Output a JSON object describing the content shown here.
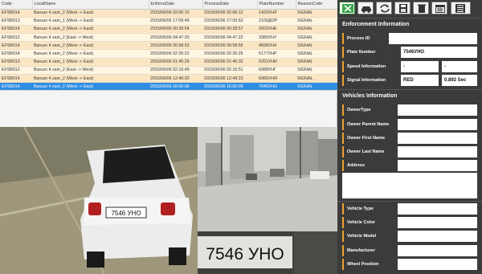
{
  "table": {
    "columns": [
      "Code",
      "LocalName",
      "EnforceDate",
      "ProcessDate",
      "PlateNumber",
      "ReasonCode"
    ],
    "rows": [
      [
        "EFSB014",
        "Baruun 4 zam_2 (West -> East)",
        "2015/06/06 02:06:10",
        "2015/06/06 02:06:12",
        "1429УНЛ",
        "SIGNAL"
      ],
      [
        "EFSB013",
        "Baruun 4 zam_1 (West -> East)",
        "2015/06/06 17:09:49",
        "2015/06/06 17:09:52",
        "2100ДОР",
        "SIGNAL"
      ],
      [
        "EFSB014",
        "Baruun 4 zam_2 (West -> East)",
        "2015/06/06 00:28:54",
        "2015/06/06 00:28:57",
        "2602УНЕ",
        "SIGNAL"
      ],
      [
        "EFSB012",
        "Baruun 4 zam_2 (East -> West)",
        "2015/06/06 04:47:20",
        "2015/06/06 04:47:22",
        "3380УНУ",
        "SIGNAL"
      ],
      [
        "EFSB014",
        "Baruun 4 zam_2 (West -> East)",
        "2015/06/06 00:58:53",
        "2015/06/06 00:58:55",
        "4838УНХ",
        "SIGNAL"
      ],
      [
        "EFSB014",
        "Baruun 4 zam_2 (West -> East)",
        "2015/06/06 02:26:22",
        "2015/06/06 02:26:25",
        "5177УНР",
        "SIGNAL"
      ],
      [
        "EFSB013",
        "Baruun 4 zam_1 (West -> East)",
        "2015/06/06 01:45:29",
        "2015/06/06 01:45:32",
        "5201УНИ",
        "SIGNAL"
      ],
      [
        "EFSB012",
        "Baruun 4 zam_2 (East -> West)",
        "2015/06/06 02:16:49",
        "2015/06/06 02:16:51",
        "6088УНГ",
        "SIGNAL"
      ],
      [
        "EFSB014",
        "Baruun 4 zam_2 (West -> East)",
        "2015/06/06 12:49:20",
        "2015/06/06 12:49:23",
        "6965УНЯ",
        "SIGNAL"
      ],
      [
        "EFSB014",
        "Baruun 4 zam_2 (West -> East)",
        "2015/06/06 16:00:06",
        "2015/06/06 16:00:09",
        "7546УНО",
        "SIGNAL"
      ]
    ],
    "selected_index": 9
  },
  "images": {
    "car_plate": "7546 УНО",
    "crop_plate": "7546 УНО"
  },
  "toolbar": {
    "buttons": [
      "excel-icon",
      "car-icon",
      "refresh-icon",
      "save-icon",
      "trash-icon",
      "calendar-icon",
      "list-icon"
    ],
    "accent": "#3aa64a"
  },
  "enforcement": {
    "title": "Enforcement Information",
    "process_id_label": "Process ID",
    "process_id": "",
    "plate_label": "Plate Number",
    "plate": "7546УНО",
    "speed_label": "Speed Information",
    "speed_a": "-",
    "speed_b": "-",
    "signal_label": "Signal Information",
    "signal_color": "RED",
    "signal_time": "0.892 Sec"
  },
  "vehicles": {
    "title": "Vehicles Information",
    "owner_type_label": "OwnerType",
    "owner_parent_label": "Owner Parent Name",
    "owner_first_label": "Owner First Name",
    "owner_last_label": "Owner Last Name",
    "address_label": "Address",
    "vehicle_type_label": "Vehicle Type",
    "vehicle_color_label": "Vehicle Color",
    "vehicle_model_label": "Vehicle Model",
    "manufacturer_label": "Manufacturer",
    "wheel_position_label": "Wheel Position"
  }
}
